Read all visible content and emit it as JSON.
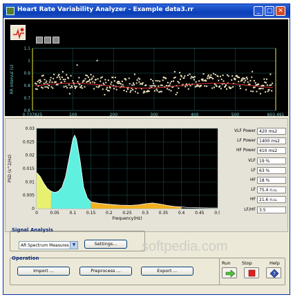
{
  "window": {
    "title": "Heart Rate Variability Analyzer - Example data3.rr"
  },
  "titlebar_buttons": {
    "minimize": "_",
    "maximize": "□",
    "close": "✕"
  },
  "rr_chart": {
    "ylabel": "RR interval (s)",
    "xlabel": "Time (s)",
    "y_ticks": [
      "1.1",
      "1",
      "0.9",
      "0.8",
      "0.7",
      "0.6"
    ],
    "x_ticks": [
      "0.737825",
      "100",
      "200",
      "300",
      "400",
      "500",
      "603.491"
    ],
    "colors": {
      "points": "#f3e6c0",
      "trend": "#e03030",
      "grid": "#2a6e6e"
    }
  },
  "chart_data": {
    "type": "area",
    "title": "",
    "xlabel": "Frequency(Hz)",
    "ylabel": "PSD (s^2/Hz)",
    "xlim": [
      0,
      0.5
    ],
    "ylim": [
      0,
      0.03
    ],
    "x_ticks": [
      "0",
      "0.05",
      "0.1",
      "0.15",
      "0.2",
      "0.25",
      "0.3",
      "0.35",
      "0.4",
      "0.45",
      "0.5"
    ],
    "y_ticks": [
      "0.03",
      "0.025",
      "0.02",
      "0.015",
      "0.01",
      "0.005",
      "0"
    ],
    "bands": [
      {
        "name": "VLF",
        "range": [
          0,
          0.04
        ],
        "color": "#e8f070"
      },
      {
        "name": "LF",
        "range": [
          0.04,
          0.15
        ],
        "color": "#60f0e0"
      },
      {
        "name": "HF",
        "range": [
          0.15,
          0.4
        ],
        "color": "#f0b020"
      }
    ],
    "x": [
      0,
      0.01,
      0.02,
      0.03,
      0.04,
      0.05,
      0.06,
      0.07,
      0.08,
      0.09,
      0.1,
      0.105,
      0.11,
      0.12,
      0.13,
      0.14,
      0.15,
      0.17,
      0.2,
      0.23,
      0.26,
      0.28,
      0.3,
      0.32,
      0.34,
      0.36,
      0.38,
      0.4,
      0.42,
      0.45,
      0.48,
      0.5
    ],
    "y": [
      0.0135,
      0.012,
      0.0095,
      0.0075,
      0.0065,
      0.006,
      0.0065,
      0.008,
      0.012,
      0.019,
      0.026,
      0.0275,
      0.026,
      0.018,
      0.008,
      0.004,
      0.0025,
      0.002,
      0.0016,
      0.0013,
      0.0012,
      0.0014,
      0.0018,
      0.0021,
      0.0017,
      0.0012,
      0.0008,
      0.0006,
      0.0004,
      0.0003,
      0.0002,
      0.0002
    ]
  },
  "metrics": [
    {
      "label": "VLF Power",
      "value": "420 ms2"
    },
    {
      "label": "LF Power",
      "value": "1400 ms2"
    },
    {
      "label": "HF Power",
      "value": "410 ms2"
    },
    {
      "label": "VLF",
      "value": "19 %"
    },
    {
      "label": "LF",
      "value": "63 %"
    },
    {
      "label": "HF",
      "value": "18 %"
    },
    {
      "label": "LF",
      "value": "75.4 n.u."
    },
    {
      "label": "HF",
      "value": "21.6 n.u."
    },
    {
      "label": "LF/HF",
      "value": "3.5"
    }
  ],
  "signal_analysis": {
    "title": "Signal Analysis",
    "dropdown_value": "AR Spectrum Measures",
    "settings_label": "Settings..."
  },
  "operation": {
    "title": "Operation",
    "import_label": "Import ...",
    "preprocess_label": "Preprocess ...",
    "export_label": "Export ..."
  },
  "controls": {
    "run_label": "Run",
    "stop_label": "Stop",
    "help_label": "Help"
  },
  "watermark": "softpedia.com"
}
